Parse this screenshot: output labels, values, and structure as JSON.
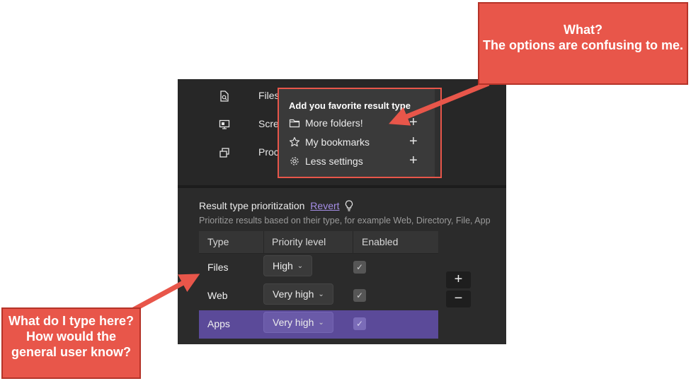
{
  "top_list": {
    "items": [
      {
        "label": "Files",
        "icon": "file-search-icon"
      },
      {
        "label": "Screens",
        "icon": "monitor-icon"
      },
      {
        "label": "Processes",
        "icon": "windows-icon"
      }
    ]
  },
  "popup": {
    "title": "Add you favorite result type",
    "items": [
      {
        "label": "More folders!",
        "icon": "folder-icon",
        "action": "+"
      },
      {
        "label": "My bookmarks",
        "icon": "star-icon",
        "action": "+"
      },
      {
        "label": "Less settings",
        "icon": "gear-icon",
        "action": "+"
      }
    ]
  },
  "prioritization": {
    "title": "Result type prioritization",
    "revert": "Revert",
    "description": "Prioritize results based on their type, for example Web, Directory, File, App"
  },
  "table": {
    "headers": {
      "type": "Type",
      "priority": "Priority level",
      "enabled": "Enabled"
    },
    "rows": [
      {
        "type": "Files",
        "priority": "High",
        "enabled": "✓"
      },
      {
        "type": "Web",
        "priority": "Very high",
        "enabled": "✓"
      },
      {
        "type": "Apps",
        "priority": "Very high",
        "enabled": "✓"
      }
    ],
    "chevron": "⌄"
  },
  "controls": {
    "add": "+",
    "remove": "−"
  },
  "callouts": {
    "top_right": "What?\nThe options are confusing to me.",
    "bottom_left": "What do I type here? How would the general user know?"
  },
  "colors": {
    "callout": "#e8564a",
    "accent_link": "#a58ee6",
    "selected_row": "#5b4a99",
    "panel_bg": "#2b2b2b"
  }
}
